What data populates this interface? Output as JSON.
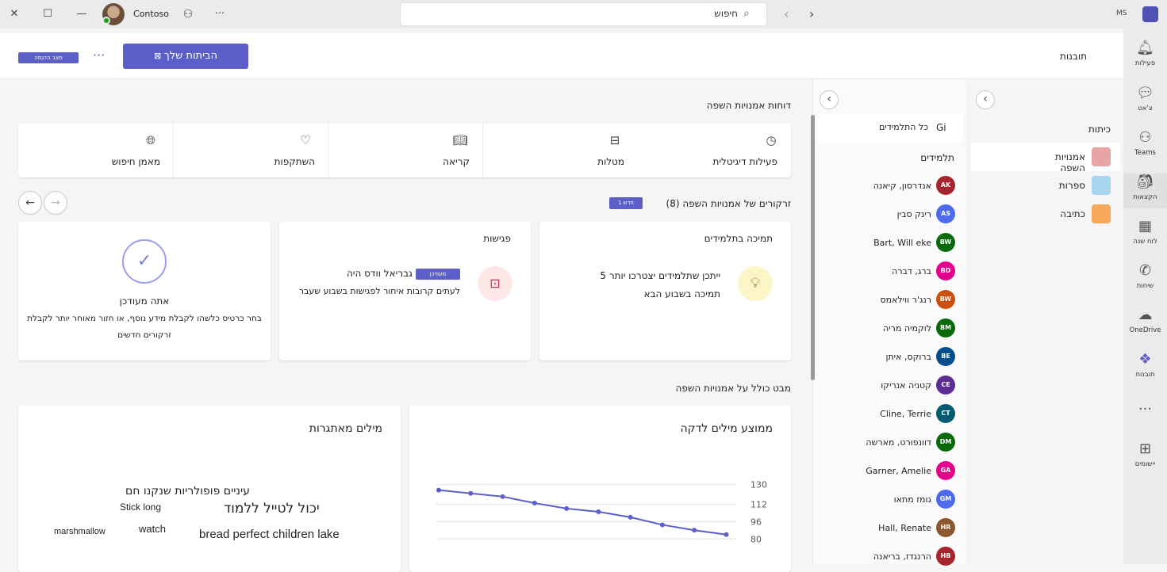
{
  "titlebar": {
    "org": "Contoso",
    "search_text": "חיפוש",
    "ms_badge": "MS"
  },
  "rail": [
    {
      "label": "פעילות",
      "icon": "bell-icon"
    },
    {
      "label": "צ'אט",
      "icon": "chat-icon"
    },
    {
      "label": "Teams",
      "icon": "teams-icon"
    },
    {
      "label": "הקצאות",
      "icon": "assignments-icon"
    },
    {
      "label": "לוח שנה",
      "icon": "calendar-icon"
    },
    {
      "label": "שיחות",
      "icon": "call-icon"
    },
    {
      "label": "OneDrive",
      "icon": "onedrive-icon"
    },
    {
      "label": "תובנות",
      "icon": "insights-icon"
    },
    {
      "label": "יישומים",
      "icon": "apps-icon"
    }
  ],
  "header": {
    "title": "תובנות",
    "main_button": "הביתות שלך",
    "badge": "מצב הדגמה"
  },
  "leftnav": {
    "section": "כיתות",
    "items": [
      "אמנויות השפה",
      "ספרות",
      "כתיבה"
    ]
  },
  "students": {
    "all_label": "כל התלמידים",
    "all_badge": "Gi",
    "section": "תלמידים",
    "list": [
      {
        "name": "אנדרסון, קיאנה",
        "initials": "AK",
        "color": "#a4262c"
      },
      {
        "name": "רינק סבין",
        "initials": "AS",
        "color": "#4f6bed"
      },
      {
        "name": "Bart, Will eke",
        "initials": "BW",
        "color": "#0b6a0b"
      },
      {
        "name": "ברג, דברה",
        "initials": "BD",
        "color": "#e3008c"
      },
      {
        "name": "רנג'ר ווילאמס",
        "initials": "BW",
        "color": "#ca5010"
      },
      {
        "name": "לוקמיה מריה",
        "initials": "BM",
        "color": "#0b6a0b"
      },
      {
        "name": "ברוקס, איתן",
        "initials": "BE",
        "color": "#004e8c"
      },
      {
        "name": "קטניה אנריקו",
        "initials": "CE",
        "color": "#5c2e91"
      },
      {
        "name": "Cline, Terrie",
        "initials": "CT",
        "color": "#005b70"
      },
      {
        "name": "דוונפורט, מארשה",
        "initials": "DM",
        "color": "#0b6a0b"
      },
      {
        "name": "Garner, Amelie",
        "initials": "GA",
        "color": "#e3008c"
      },
      {
        "name": "גומז מתאו",
        "initials": "GM",
        "color": "#4f6bed"
      },
      {
        "name": "Hall, Renate",
        "initials": "HR",
        "color": "#8e562e"
      },
      {
        "name": "הרנגדז, בריאנה",
        "initials": "HB",
        "color": "#a4262c"
      }
    ]
  },
  "main": {
    "reports_title": "דוחות אמנויות השפה",
    "categories": [
      "פעילות דיגיטלית",
      "מטלות",
      "קריאה",
      "השתקפות",
      "מאמן חיפוש"
    ],
    "spotlight_title": "זרקורים של אמנויות השפה (8)",
    "spotlight_new": "1 חדש",
    "card1": {
      "title": "תמיכה בתלמידים",
      "line1": "5 ייתכן שתלמידים יצטרכו יותר",
      "line2": "תמיכה בשבוע הבא"
    },
    "card2": {
      "title": "פגישות",
      "badge": "מעודכן",
      "line1": "גבריאל וודס היה",
      "line2": "לעתים קרובות איחור לפגישות בשבוע שעבר"
    },
    "card3": {
      "title": "אתה מעודכן",
      "line1": "בחר כרטיס כלשהו לקבלת מידע נוסף, או חזור מאוחר יותר לקבלת",
      "line2": "זרקורים חדשים"
    },
    "overview_title": "מבט כולל על אמנויות השפה",
    "wpm_title": "ממוצע מילים לדקה",
    "words_title": "מילים מאתגרות",
    "word_cloud": [
      {
        "text": "עיניים פופולריות שנקנו חם",
        "size": 14
      },
      {
        "text": "Stick long",
        "size": 12
      },
      {
        "text": "יכול לטייל ללמוד",
        "size": 17
      },
      {
        "text": "marshmallow",
        "size": 11
      },
      {
        "text": "watch",
        "size": 13
      },
      {
        "text": "bread perfect children lake",
        "size": 15
      }
    ]
  },
  "chart_data": {
    "type": "line",
    "title": "ממוצע מילים לדקה",
    "yticks": [
      130,
      112,
      96,
      80
    ],
    "ylim": [
      78,
      132
    ],
    "series": [
      {
        "values": [
          125,
          122,
          119,
          113,
          108,
          105,
          100,
          93,
          88,
          84
        ]
      }
    ]
  }
}
